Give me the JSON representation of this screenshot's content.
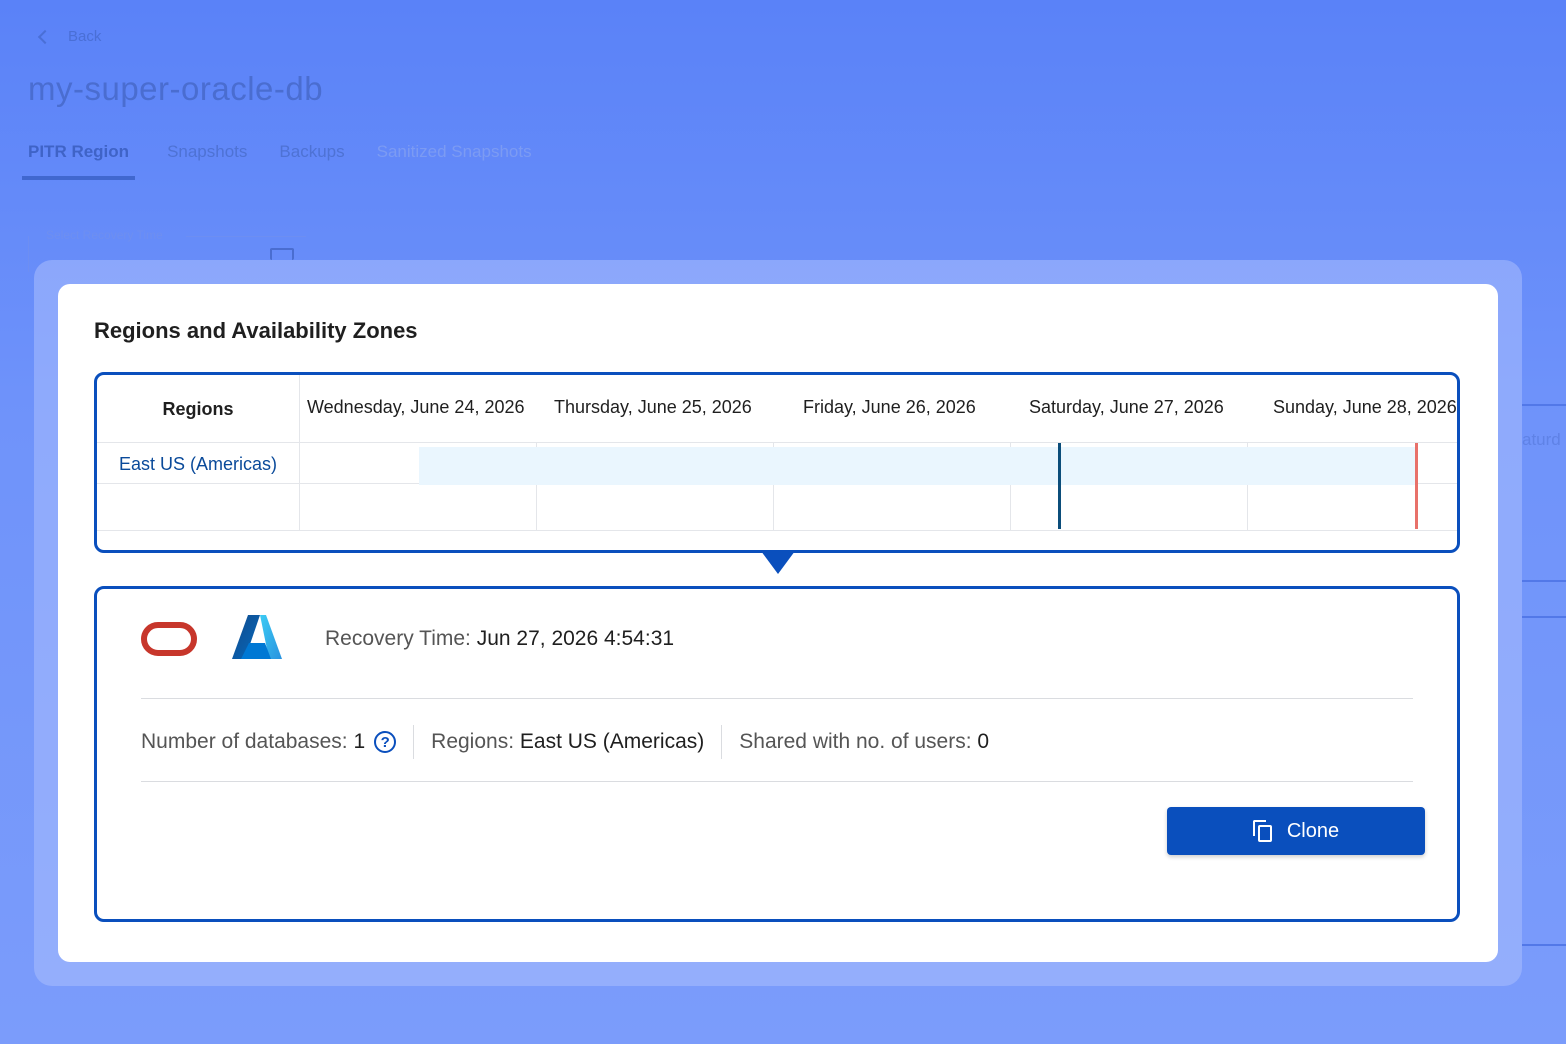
{
  "background": {
    "back_label": "Back",
    "page_title": "my-super-oracle-db",
    "tabs": [
      {
        "label": "PITR Region"
      },
      {
        "label": "Snapshots"
      },
      {
        "label": "Backups"
      },
      {
        "label": "Sanitized Snapshots"
      }
    ],
    "field_label": "Select Recovery Time",
    "right_text": "aturd"
  },
  "modal": {
    "title": "Regions and Availability Zones",
    "timeline": {
      "regions_header": "Regions",
      "days": [
        "Wednesday, June 24, 2026",
        "Thursday, June 25, 2026",
        "Friday, June 26, 2026",
        "Saturday, June 27, 2026",
        "Sunday, June 28, 2026"
      ],
      "regions": [
        "East US (Americas)"
      ],
      "selected_marker_color": "#0b4d7a",
      "now_marker_color": "#e8716a",
      "availability_color": "#eaf6fe"
    },
    "detail": {
      "logos": [
        "oracle-logo",
        "azure-logo"
      ],
      "recovery_label": "Recovery Time:",
      "recovery_value": "Jun 27, 2026 4:54:31",
      "db_label": "Number of databases:",
      "db_value": "1",
      "regions_label": "Regions:",
      "regions_value": "East US (Americas)",
      "shared_label": "Shared with no. of users:",
      "shared_value": "0",
      "clone_label": "Clone"
    },
    "accent": "#0a4fbd"
  }
}
